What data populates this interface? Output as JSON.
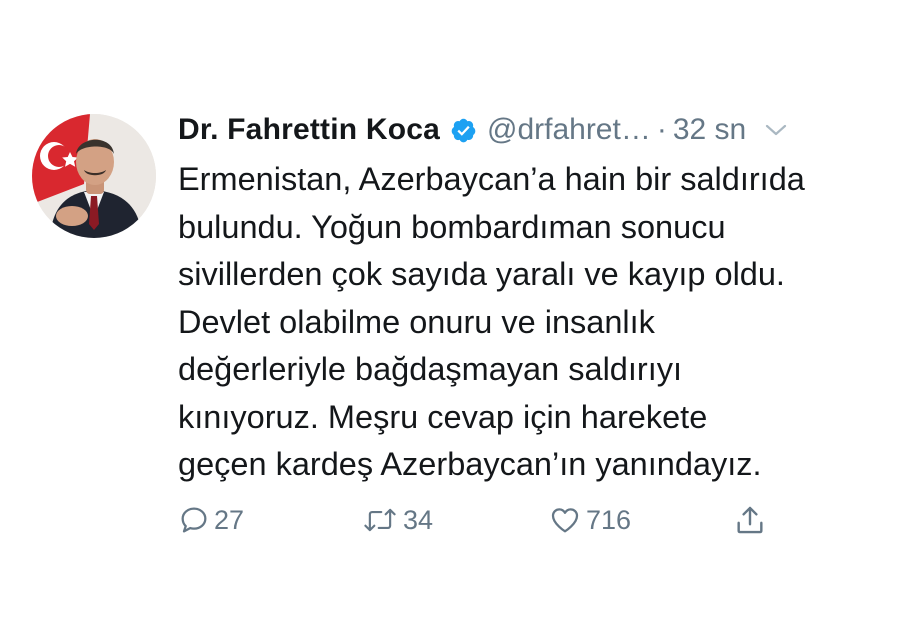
{
  "tweet": {
    "display_name": "Dr. Fahrettin Koca",
    "verified": true,
    "handle": "@drfahret…",
    "separator": "·",
    "timestamp": "32 sn",
    "body_lines": [
      "Ermenistan, Azerbaycan’a hain bir saldırıda",
      "bulundu. Yoğun bombardıman sonucu",
      "sivillerden çok sayıda yaralı ve kayıp oldu.",
      "Devlet olabilme onuru ve insanlık",
      "değerleriyle bağdaşmayan saldırıyı",
      "kınıyoruz. Meşru cevap için harekete",
      "geçen kardeş Azerbaycan’ın yanındayız."
    ],
    "actions": {
      "reply_count": "27",
      "retweet_count": "34",
      "like_count": "716"
    }
  },
  "colors": {
    "text": "#14171a",
    "secondary": "#657786",
    "verified_badge": "#1da1f2"
  },
  "icons": {
    "verified": "verified-badge-icon",
    "menu": "chevron-down-icon",
    "reply": "reply-icon",
    "retweet": "retweet-icon",
    "like": "heart-icon",
    "share": "share-icon"
  }
}
